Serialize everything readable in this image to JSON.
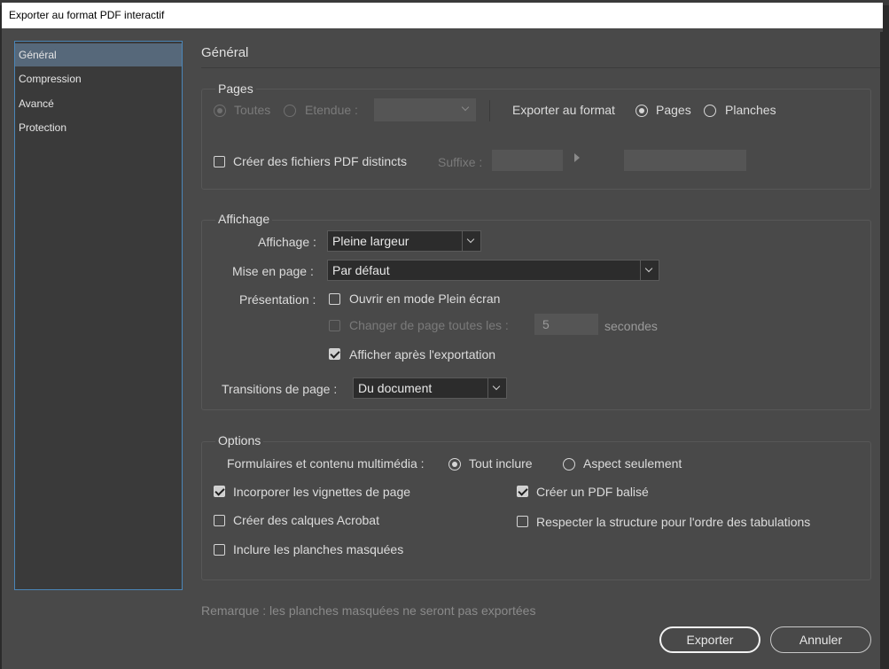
{
  "window": {
    "title": "Exporter au format PDF interactif"
  },
  "sidebar": {
    "items": [
      "Général",
      "Compression",
      "Avancé",
      "Protection"
    ],
    "selected": "Général"
  },
  "section_title": "Général",
  "pages": {
    "title": "Pages",
    "all": "Toutes",
    "range": "Etendue :",
    "export_as": "Exporter au format",
    "export_pages": "Pages",
    "export_spreads": "Planches",
    "separate_files": "Créer des fichiers PDF distincts",
    "separate_files_checked": false,
    "suffix": "Suffixe :"
  },
  "display": {
    "title": "Affichage",
    "view_label": "Affichage :",
    "view_value": "Pleine largeur",
    "layout_label": "Mise en page :",
    "layout_value": "Par défaut",
    "presentation_label": "Présentation :",
    "fullscreen": "Ouvrir en mode Plein écran",
    "fullscreen_checked": false,
    "flip_every": "Changer de page toutes les :",
    "flip_value": "5",
    "seconds": "secondes",
    "view_after": "Afficher après l'exportation",
    "view_after_checked": true,
    "transitions_label": "Transitions de page :",
    "transitions_value": "Du document"
  },
  "options": {
    "title": "Options",
    "forms_label": "Formulaires et contenu multimédia :",
    "include_all": "Tout inclure",
    "appearance_only": "Aspect seulement",
    "thumbnails": "Incorporer les vignettes de page",
    "thumbnails_checked": true,
    "tagged_pdf": "Créer un PDF balisé",
    "tagged_pdf_checked": true,
    "acrobat_layers": "Créer des calques Acrobat",
    "acrobat_layers_checked": false,
    "tab_order": "Respecter la structure pour l'ordre des tabulations",
    "tab_order_checked": false,
    "hidden_spreads": "Inclure les planches masquées",
    "hidden_spreads_checked": false
  },
  "note": "Remarque : les planches masquées ne seront pas exportées",
  "buttons": {
    "export": "Exporter",
    "cancel": "Annuler"
  }
}
